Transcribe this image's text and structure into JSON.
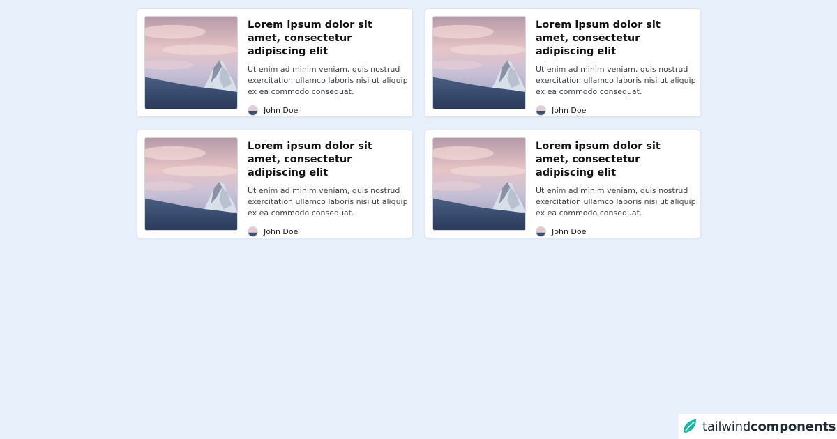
{
  "cards": [
    {
      "title": "Lorem ipsum dolor sit amet, consectetur adipiscing elit",
      "description": "Ut enim ad minim veniam, quis nostrud exercitation ullamco laboris nisi ut aliquip ex ea commodo consequat.",
      "author": "John Doe",
      "image_icon": "mountain-photo",
      "avatar_icon": "avatar-photo"
    },
    {
      "title": "Lorem ipsum dolor sit amet, consectetur adipiscing elit",
      "description": "Ut enim ad minim veniam, quis nostrud exercitation ullamco laboris nisi ut aliquip ex ea commodo consequat.",
      "author": "John Doe",
      "image_icon": "mountain-photo",
      "avatar_icon": "avatar-photo"
    },
    {
      "title": "Lorem ipsum dolor sit amet, consectetur adipiscing elit",
      "description": "Ut enim ad minim veniam, quis nostrud exercitation ullamco laboris nisi ut aliquip ex ea commodo consequat.",
      "author": "John Doe",
      "image_icon": "mountain-photo",
      "avatar_icon": "avatar-photo"
    },
    {
      "title": "Lorem ipsum dolor sit amet, consectetur adipiscing elit",
      "description": "Ut enim ad minim veniam, quis nostrud exercitation ullamco laboris nisi ut aliquip ex ea commodo consequat.",
      "author": "John Doe",
      "image_icon": "mountain-photo",
      "avatar_icon": "avatar-photo"
    }
  ],
  "brand": {
    "name_light": "tailwind",
    "name_bold": "components",
    "icon": "tailwind-leaf-icon",
    "accent": "#16b8a6"
  },
  "colors": {
    "page_background": "#e8f1fb",
    "card_background": "#ffffff"
  }
}
